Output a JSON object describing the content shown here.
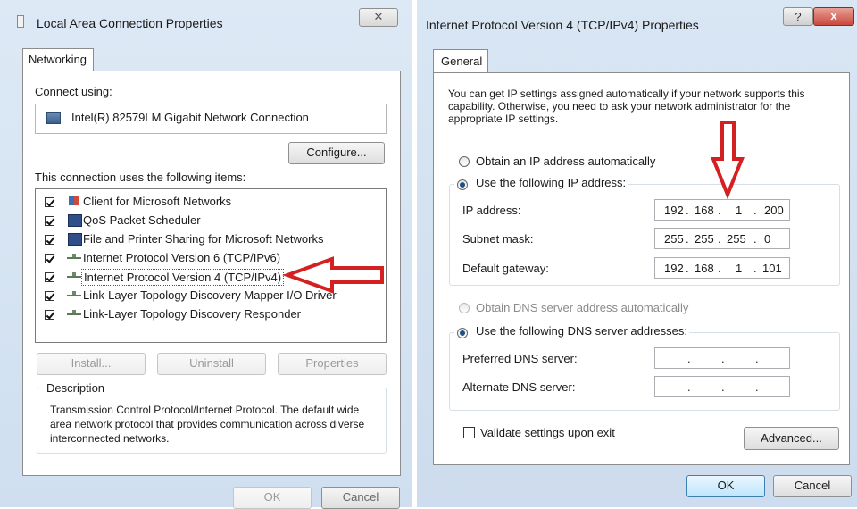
{
  "left_dialog": {
    "title": "Local Area Connection Properties",
    "tab": "Networking",
    "connect_using_label": "Connect using:",
    "adapter": "Intel(R) 82579LM Gigabit Network Connection",
    "configure_label": "Configure...",
    "items_label": "This connection uses the following items:",
    "items": [
      {
        "label": "Client for Microsoft Networks",
        "checked": true,
        "icon": "network-client-icon"
      },
      {
        "label": "QoS Packet Scheduler",
        "checked": true,
        "icon": "computer-icon"
      },
      {
        "label": "File and Printer Sharing for Microsoft Networks",
        "checked": true,
        "icon": "computer-icon"
      },
      {
        "label": "Internet Protocol Version 6 (TCP/IPv6)",
        "checked": true,
        "icon": "protocol-icon"
      },
      {
        "label": "Internet Protocol Version 4 (TCP/IPv4)",
        "checked": true,
        "icon": "protocol-icon",
        "selected": true
      },
      {
        "label": "Link-Layer Topology Discovery Mapper I/O Driver",
        "checked": true,
        "icon": "protocol-icon"
      },
      {
        "label": "Link-Layer Topology Discovery Responder",
        "checked": true,
        "icon": "protocol-icon"
      }
    ],
    "install_label": "Install...",
    "uninstall_label": "Uninstall",
    "properties_label": "Properties",
    "description_label": "Description",
    "description_text": "Transmission Control Protocol/Internet Protocol. The default wide area network protocol that provides communication across diverse interconnected networks.",
    "ok_label": "OK",
    "cancel_label": "Cancel"
  },
  "right_dialog": {
    "title": "Internet Protocol Version 4 (TCP/IPv4) Properties",
    "help_glyph": "?",
    "close_glyph": "x",
    "tab": "General",
    "intro": "You can get IP settings assigned automatically if your network supports this capability. Otherwise, you need to ask your network administrator for the appropriate IP settings.",
    "obtain_ip_auto": "Obtain an IP address automatically",
    "use_following_ip": "Use the following IP address:",
    "ip_address_label": "IP address:",
    "ip_address": [
      "192",
      "168",
      "1",
      "200"
    ],
    "subnet_mask_label": "Subnet mask:",
    "subnet_mask": [
      "255",
      "255",
      "255",
      "0"
    ],
    "gateway_label": "Default gateway:",
    "gateway": [
      "192",
      "168",
      "1",
      "101"
    ],
    "obtain_dns_auto": "Obtain DNS server address automatically",
    "use_following_dns": "Use the following DNS server addresses:",
    "preferred_dns_label": "Preferred DNS server:",
    "alternate_dns_label": "Alternate DNS server:",
    "validate_label": "Validate settings upon exit",
    "advanced_label": "Advanced...",
    "ok_label": "OK",
    "cancel_label": "Cancel"
  },
  "colors": {
    "annotation_arrow": "#d42020",
    "title_glass": "#c9dcef",
    "close_button": "#c9483e"
  }
}
